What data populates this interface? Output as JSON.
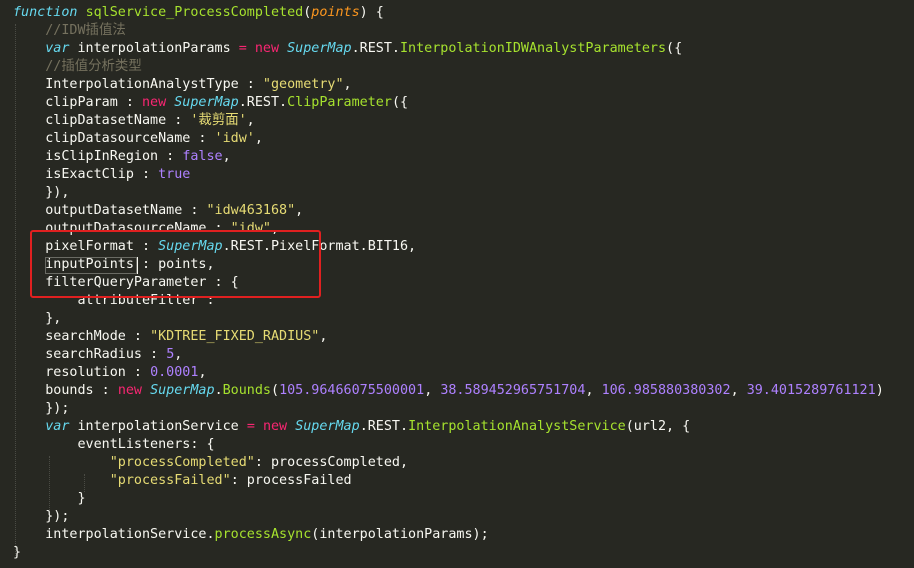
{
  "code": {
    "lines": [
      [
        {
          "t": "function",
          "c": "storage"
        },
        {
          "t": " ",
          "c": "punc"
        },
        {
          "t": "sqlService_ProcessCompleted",
          "c": "entity"
        },
        {
          "t": "(",
          "c": "punc"
        },
        {
          "t": "points",
          "c": "param"
        },
        {
          "t": ") {",
          "c": "punc"
        }
      ],
      [
        {
          "t": "    //IDW插值法",
          "c": "comment"
        }
      ],
      [
        {
          "t": "    ",
          "c": "punc"
        },
        {
          "t": "var",
          "c": "storage"
        },
        {
          "t": " interpolationParams ",
          "c": "prop"
        },
        {
          "t": "=",
          "c": "op"
        },
        {
          "t": " ",
          "c": "punc"
        },
        {
          "t": "new",
          "c": "op"
        },
        {
          "t": " ",
          "c": "punc"
        },
        {
          "t": "SuperMap",
          "c": "class"
        },
        {
          "t": ".REST.",
          "c": "punc"
        },
        {
          "t": "InterpolationIDWAnalystParameters",
          "c": "support"
        },
        {
          "t": "({",
          "c": "punc"
        }
      ],
      [
        {
          "t": "    //插值分析类型",
          "c": "comment"
        }
      ],
      [
        {
          "t": "    InterpolationAnalystType : ",
          "c": "prop"
        },
        {
          "t": "\"geometry\"",
          "c": "string"
        },
        {
          "t": ",",
          "c": "punc"
        }
      ],
      [
        {
          "t": "    clipParam : ",
          "c": "prop"
        },
        {
          "t": "new",
          "c": "op"
        },
        {
          "t": " ",
          "c": "punc"
        },
        {
          "t": "SuperMap",
          "c": "class"
        },
        {
          "t": ".REST.",
          "c": "punc"
        },
        {
          "t": "ClipParameter",
          "c": "support"
        },
        {
          "t": "({",
          "c": "punc"
        }
      ],
      [
        {
          "t": "    clipDatasetName : ",
          "c": "prop"
        },
        {
          "t": "'裁剪面'",
          "c": "string"
        },
        {
          "t": ",",
          "c": "punc"
        }
      ],
      [
        {
          "t": "    clipDatasourceName : ",
          "c": "prop"
        },
        {
          "t": "'idw'",
          "c": "string"
        },
        {
          "t": ",",
          "c": "punc"
        }
      ],
      [
        {
          "t": "    isClipInRegion : ",
          "c": "prop"
        },
        {
          "t": "false",
          "c": "const"
        },
        {
          "t": ",",
          "c": "punc"
        }
      ],
      [
        {
          "t": "    isExactClip : ",
          "c": "prop"
        },
        {
          "t": "true",
          "c": "const"
        }
      ],
      [
        {
          "t": "    }),",
          "c": "punc"
        }
      ],
      [
        {
          "t": "    outputDatasetName : ",
          "c": "prop"
        },
        {
          "t": "\"idw463168\"",
          "c": "string"
        },
        {
          "t": ",",
          "c": "punc"
        }
      ],
      [
        {
          "t": "    outputDatasourceName : ",
          "c": "prop"
        },
        {
          "t": "\"idw\"",
          "c": "string"
        },
        {
          "t": ",",
          "c": "punc"
        }
      ],
      [
        {
          "t": "    pixelFormat : ",
          "c": "prop"
        },
        {
          "t": "SuperMap",
          "c": "class"
        },
        {
          "t": ".REST.PixelFormat.BIT16,",
          "c": "punc"
        }
      ],
      [
        {
          "t": "    inputPoints : points,",
          "c": "prop"
        }
      ],
      [
        {
          "t": "    filterQueryParameter : {",
          "c": "prop"
        }
      ],
      [
        {
          "t": "        attributeFilter : ",
          "c": "prop"
        }
      ],
      [
        {
          "t": "    },",
          "c": "punc"
        }
      ],
      [
        {
          "t": "    searchMode : ",
          "c": "prop"
        },
        {
          "t": "\"KDTREE_FIXED_RADIUS\"",
          "c": "string"
        },
        {
          "t": ",",
          "c": "punc"
        }
      ],
      [
        {
          "t": "    searchRadius : ",
          "c": "prop"
        },
        {
          "t": "5",
          "c": "const"
        },
        {
          "t": ",",
          "c": "punc"
        }
      ],
      [
        {
          "t": "    resolution : ",
          "c": "prop"
        },
        {
          "t": "0.0001",
          "c": "const"
        },
        {
          "t": ",",
          "c": "punc"
        }
      ],
      [
        {
          "t": "    bounds : ",
          "c": "prop"
        },
        {
          "t": "new",
          "c": "op"
        },
        {
          "t": " ",
          "c": "punc"
        },
        {
          "t": "SuperMap",
          "c": "class"
        },
        {
          "t": ".",
          "c": "punc"
        },
        {
          "t": "Bounds",
          "c": "support"
        },
        {
          "t": "(",
          "c": "punc"
        },
        {
          "t": "105.96466075500001",
          "c": "const"
        },
        {
          "t": ", ",
          "c": "punc"
        },
        {
          "t": "38.589452965751704",
          "c": "const"
        },
        {
          "t": ", ",
          "c": "punc"
        },
        {
          "t": "106.985880380302",
          "c": "const"
        },
        {
          "t": ", ",
          "c": "punc"
        },
        {
          "t": "39.4015289761121",
          "c": "const"
        },
        {
          "t": ")",
          "c": "punc"
        }
      ],
      [
        {
          "t": "    });",
          "c": "punc"
        }
      ],
      [
        {
          "t": "    ",
          "c": "punc"
        },
        {
          "t": "var",
          "c": "storage"
        },
        {
          "t": " interpolationService ",
          "c": "prop"
        },
        {
          "t": "=",
          "c": "op"
        },
        {
          "t": " ",
          "c": "punc"
        },
        {
          "t": "new",
          "c": "op"
        },
        {
          "t": " ",
          "c": "punc"
        },
        {
          "t": "SuperMap",
          "c": "class"
        },
        {
          "t": ".REST.",
          "c": "punc"
        },
        {
          "t": "InterpolationAnalystService",
          "c": "support"
        },
        {
          "t": "(url2, {",
          "c": "punc"
        }
      ],
      [
        {
          "t": "        eventListeners: {",
          "c": "prop"
        }
      ],
      [
        {
          "t": "            ",
          "c": "punc"
        },
        {
          "t": "\"processCompleted\"",
          "c": "string"
        },
        {
          "t": ": processCompleted,",
          "c": "punc"
        }
      ],
      [
        {
          "t": "            ",
          "c": "punc"
        },
        {
          "t": "\"processFailed\"",
          "c": "string"
        },
        {
          "t": ": processFailed",
          "c": "punc"
        }
      ],
      [
        {
          "t": "        }",
          "c": "punc"
        }
      ],
      [
        {
          "t": "    });",
          "c": "punc"
        }
      ],
      [
        {
          "t": "    interpolationService.",
          "c": "prop"
        },
        {
          "t": "processAsync",
          "c": "support"
        },
        {
          "t": "(interpolationParams);",
          "c": "punc"
        }
      ],
      [
        {
          "t": "}",
          "c": "punc"
        }
      ]
    ]
  }
}
